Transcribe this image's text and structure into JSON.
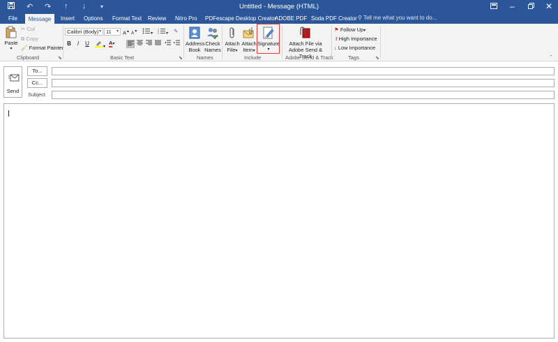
{
  "window": {
    "title": "Untitled - Message (HTML)",
    "accent_color": "#2b579a"
  },
  "quick_access": {
    "save_icon": "save-icon",
    "undo_icon": "undo-icon",
    "redo_icon": "redo-icon",
    "up_icon": "arrow-up-icon",
    "down_icon": "arrow-down-icon",
    "customize_icon": "customize-icon"
  },
  "tabs": [
    {
      "label": "File"
    },
    {
      "label": "Message"
    },
    {
      "label": "Insert"
    },
    {
      "label": "Options"
    },
    {
      "label": "Format Text"
    },
    {
      "label": "Review"
    },
    {
      "label": "Nitro Pro"
    },
    {
      "label": "PDFescape Desktop Creator"
    },
    {
      "label": "ADOBE PDF"
    },
    {
      "label": "Soda PDF Creator"
    }
  ],
  "active_tab": "Message",
  "tell_me": "Tell me what you want to do...",
  "clipboard": {
    "paste": "Paste",
    "cut": "Cut",
    "copy": "Copy",
    "format_painter": "Format Painter",
    "group": "Clipboard"
  },
  "basic_text": {
    "font": "Calibri (Body)",
    "size": "11",
    "bold": "B",
    "italic": "I",
    "underline": "U",
    "font_color_letter": "A",
    "highlight_color": "#ffff00",
    "font_color": "#e53935",
    "group": "Basic Text"
  },
  "names": {
    "address_book_1": "Address",
    "address_book_2": "Book",
    "check_names_1": "Check",
    "check_names_2": "Names",
    "group": "Names"
  },
  "include": {
    "attach_file_1": "Attach",
    "attach_file_2": "File",
    "attach_item_1": "Attach",
    "attach_item_2": "Item",
    "signature": "Signature",
    "group": "Include"
  },
  "adobe": {
    "attach_via_1": "Attach File via",
    "attach_via_2": "Adobe Send & Track",
    "group": "Adobe Send & Track"
  },
  "tags": {
    "follow_up": "Follow Up",
    "high_importance": "High Importance",
    "low_importance": "Low Importance",
    "group": "Tags"
  },
  "compose": {
    "send": "Send",
    "to": "To...",
    "cc": "Cc...",
    "subject": "Subject",
    "to_value": "",
    "cc_value": "",
    "subject_value": "",
    "body": ""
  }
}
